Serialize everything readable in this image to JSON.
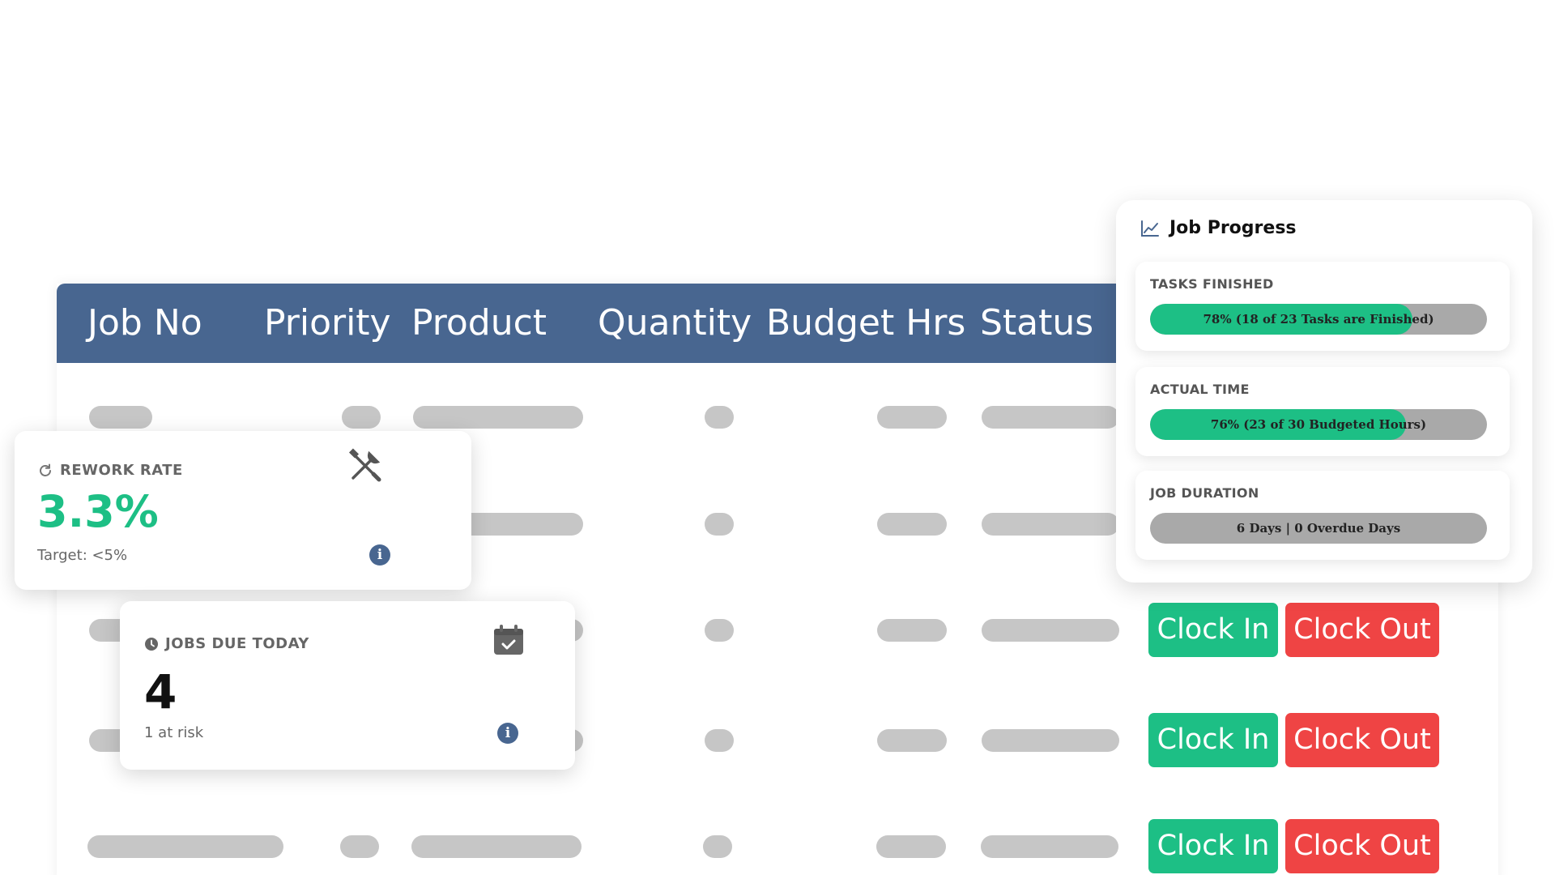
{
  "table": {
    "headers": [
      "Job No",
      "Priority",
      "Product",
      "Quantity",
      "Budget Hrs",
      "Status"
    ],
    "actions": {
      "clock_in_label": "Clock In",
      "clock_out_label": "Clock Out"
    },
    "colors": {
      "header_bg": "#486690",
      "placeholder": "#c6c6c6",
      "clock_in": "#1dbf85",
      "clock_out": "#ef4444"
    }
  },
  "rework_card": {
    "label": "REWORK RATE",
    "value": "3.3%",
    "target": "Target: <5%",
    "icon": "wrench-screwdriver-icon",
    "value_color": "#1dbf85"
  },
  "jobs_due_card": {
    "label": "JOBS DUE TODAY",
    "value": "4",
    "sub": "1 at risk",
    "icon": "calendar-check-icon"
  },
  "job_progress": {
    "title": "Job Progress",
    "metrics": [
      {
        "label": "TASKS FINISHED",
        "text": "78% (18 of 23 Tasks are Finished)",
        "percent": 78
      },
      {
        "label": "ACTUAL TIME",
        "text": "76% (23 of 30 Budgeted Hours)",
        "percent": 76
      },
      {
        "label": "JOB DURATION",
        "text": "6 Days | 0 Overdue Days",
        "percent": 0
      }
    ]
  }
}
